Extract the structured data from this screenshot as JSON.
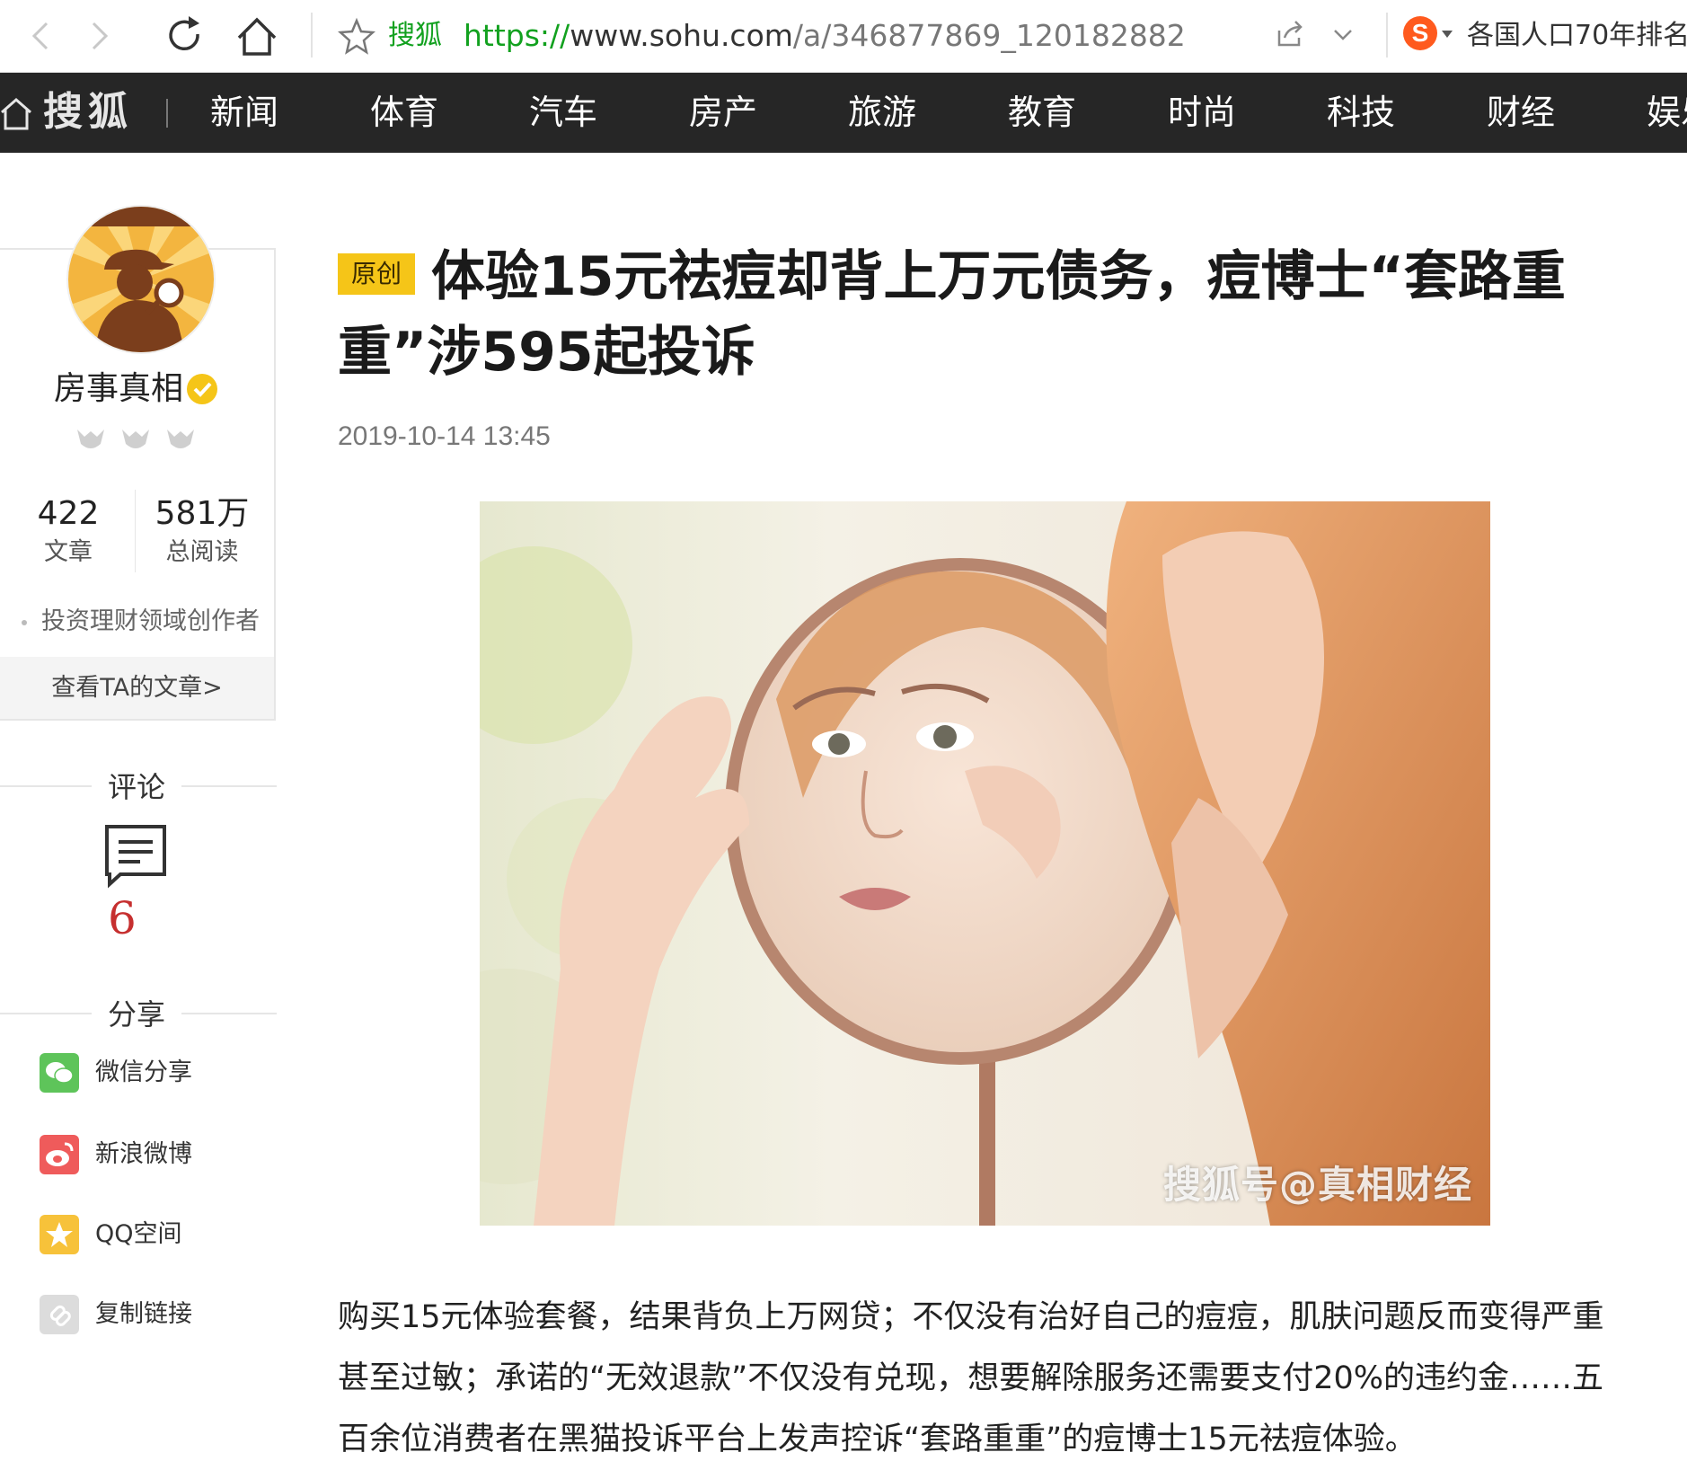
{
  "browser": {
    "site_name": "搜狐",
    "url_protocol": "https://",
    "url_host": "www.sohu.com",
    "url_path": "/a/346877869_120182882",
    "search_engine_logo_letter": "S",
    "hot_search": "各国人口70年排名"
  },
  "site_nav": {
    "logo": "搜狐",
    "items": [
      "新闻",
      "体育",
      "汽车",
      "房产",
      "旅游",
      "教育",
      "时尚",
      "科技",
      "财经",
      "娱乐"
    ]
  },
  "author": {
    "name": "房事真相",
    "articles_count": "422",
    "articles_label": "文章",
    "reads_count": "581万",
    "reads_label": "总阅读",
    "domain": "投资理财领域创作者",
    "view_articles": "查看TA的文章>"
  },
  "comments": {
    "title": "评论",
    "count": "6"
  },
  "share": {
    "title": "分享",
    "items": [
      {
        "label": "微信分享",
        "icon": "wechat-icon",
        "color": "#5ec45a"
      },
      {
        "label": "新浪微博",
        "icon": "weibo-icon",
        "color": "#ef5b5b"
      },
      {
        "label": "QQ空间",
        "icon": "qzone-icon",
        "color": "#f7c23a"
      },
      {
        "label": "复制链接",
        "icon": "link-icon",
        "color": "#dcdcdc"
      }
    ]
  },
  "article": {
    "badge": "原创",
    "title": "体验15元祛痘却背上万元债务，痘博士“套路重重”涉595起投诉",
    "time": "2019-10-14 13:45",
    "image_watermark": "搜狐号@真相财经",
    "body": "购买15元体验套餐，结果背负上万网贷；不仅没有治好自己的痘痘，肌肤问题反而变得严重甚至过敏；承诺的“无效退款”不仅没有兑现，想要解除服务还需要支付20%的违约金……五百余位消费者在黑猫投诉平台上发声控诉“套路重重”的痘博士15元祛痘体验。"
  },
  "colors": {
    "nav_bg": "#262626",
    "accent_green": "#12a11f",
    "badge_yellow": "#f5c518",
    "comment_red": "#c62f2f"
  }
}
